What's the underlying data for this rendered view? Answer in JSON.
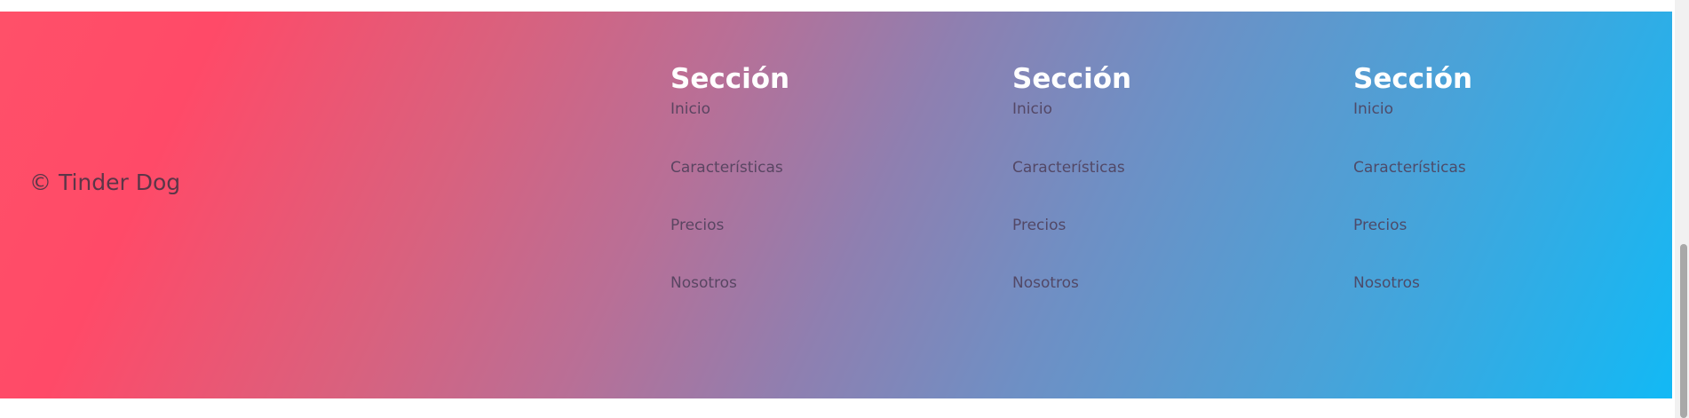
{
  "footer": {
    "copyright": "© Tinder Dog",
    "columns": [
      {
        "title": "Sección",
        "links": [
          "Inicio",
          "Características",
          "Precios",
          "Nosotros"
        ]
      },
      {
        "title": "Sección",
        "links": [
          "Inicio",
          "Características",
          "Precios",
          "Nosotros"
        ]
      },
      {
        "title": "Sección",
        "links": [
          "Inicio",
          "Características",
          "Precios",
          "Nosotros"
        ]
      }
    ],
    "colors": {
      "gradient_start": "#ff4a68",
      "gradient_end": "#12b9f5",
      "title": "#ffffff",
      "link": "#4e3f5a"
    }
  }
}
